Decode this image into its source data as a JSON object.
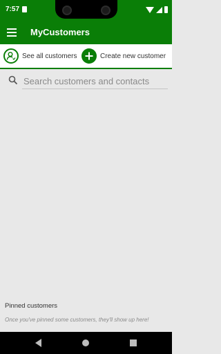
{
  "status_bar": {
    "time": "7:57"
  },
  "app_bar": {
    "title": "MyCustomers"
  },
  "actions": {
    "see_all_label": "See all customers",
    "create_label": "Create new customer"
  },
  "search": {
    "placeholder": "Search customers and contacts",
    "value": ""
  },
  "pinned": {
    "title": "Pinned customers",
    "empty_message": "Once you've pinned some customers, they'll show up here!"
  },
  "colors": {
    "brand": "#0a7e07",
    "background": "#e8e8e8"
  },
  "icons": [
    "menu-icon",
    "person-icon",
    "plus-icon",
    "search-icon",
    "back-icon",
    "home-icon",
    "recents-icon"
  ]
}
